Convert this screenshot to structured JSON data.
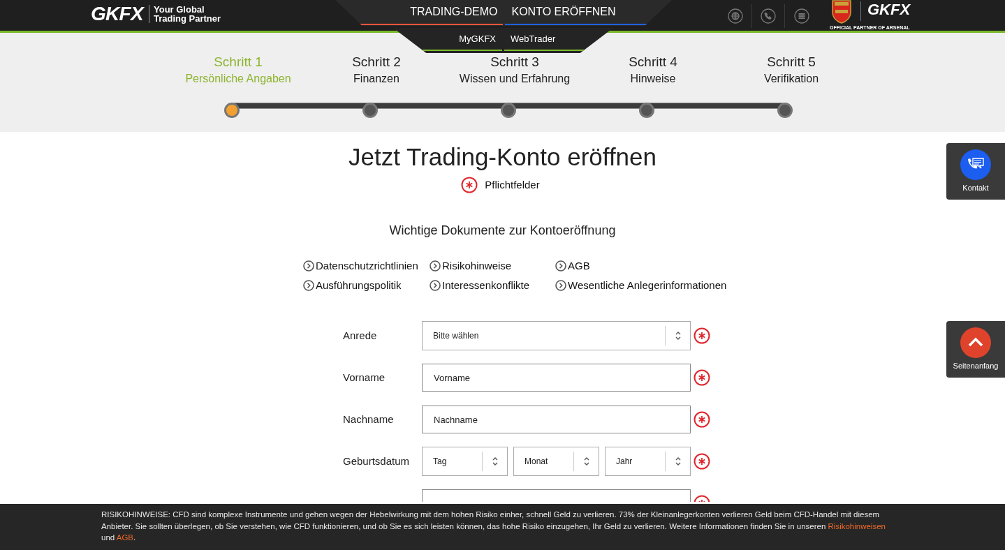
{
  "header": {
    "logo": "GKFX",
    "tagline": [
      "Your Global",
      "Trading Partner"
    ],
    "nav": [
      {
        "label": "TRADING-DEMO",
        "color": "#e8553a"
      },
      {
        "label": "KONTO ERÖFFNEN",
        "color": "#1e63e0"
      }
    ],
    "subnav": [
      {
        "label": "MyGKFX",
        "color": "#7ab829"
      },
      {
        "label": "WebTrader",
        "color": "#7ab829"
      }
    ],
    "tools": [
      {
        "kind": "globe"
      },
      {
        "kind": "phone"
      },
      {
        "kind": "menu"
      }
    ],
    "partner_logo": "GKFX",
    "partner_caption": "OFFICIAL PARTNER OF ARSENAL"
  },
  "steps": [
    {
      "title": "Schritt 1",
      "subtitle": "Persönliche Angaben",
      "selected": true
    },
    {
      "title": "Schritt 2",
      "subtitle": "Finanzen",
      "selected": false
    },
    {
      "title": "Schritt 3",
      "subtitle": "Wissen und Erfahrung",
      "selected": false
    },
    {
      "title": "Schritt 4",
      "subtitle": "Hinweise",
      "selected": false
    },
    {
      "title": "Schritt 5",
      "subtitle": "Verifikation",
      "selected": false
    }
  ],
  "title": "Jetzt Trading-Konto eröffnen",
  "required_legend": "Pflichtfelder",
  "documents": {
    "heading": "Wichtige Dokumente zur Kontoeröffnung",
    "links": [
      "Datenschutzrichtlinien",
      "Risikohinweise",
      "AGB",
      "Ausführungspolitik",
      "Interessenkonflikte",
      "Wesentliche Anlegerinformationen"
    ]
  },
  "form": [
    {
      "label": "Anrede",
      "kind": "select",
      "values": [
        "Bitte wählen"
      ],
      "required": true
    },
    {
      "label": "Vorname",
      "kind": "text",
      "placeholder": "Vorname",
      "required": true
    },
    {
      "label": "Nachname",
      "kind": "text",
      "placeholder": "Nachname",
      "required": true
    },
    {
      "label": "Geburtsdatum",
      "kind": "date",
      "values": [
        "Tag",
        "Monat",
        "Jahr"
      ],
      "required": true
    },
    {
      "kind": "text",
      "required": true
    }
  ],
  "side_buttons": [
    {
      "label": "Kontakt",
      "kind": "contact"
    },
    {
      "label": "Seitenanfang",
      "kind": "top"
    }
  ],
  "risk_notice": {
    "text": "RISIKOHINWEISE: CFD sind komplexe Instrumente und gehen wegen der Hebelwirkung mit dem hohen Risiko einher, schnell Geld zu verlieren. 73% der Kleinanlegerkonten verlieren Geld beim CFD-Handel mit diesem Anbieter. Sie sollten überlegen, ob Sie verstehen, wie CFD funktionieren, und ob Sie es sich leisten können, das hohe Risiko einzugehen, Ihr Geld zu verlieren. Weitere Informationen finden Sie in unseren",
    "links": [
      "Risikohinweisen",
      "AGB"
    ],
    "joiner": "und",
    "end": "."
  }
}
